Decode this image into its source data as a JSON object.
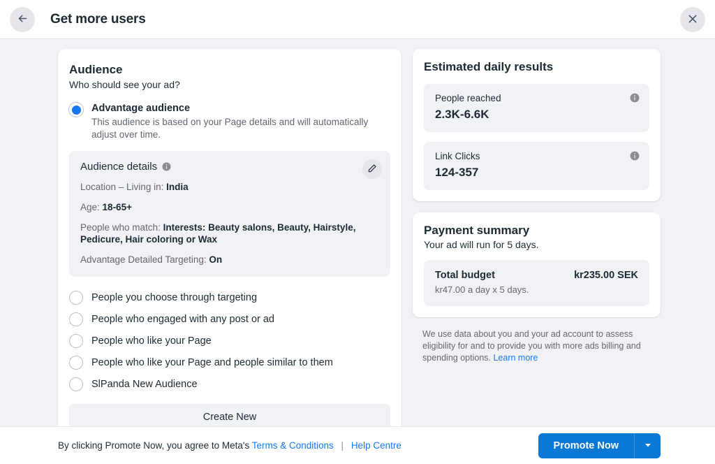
{
  "header": {
    "title": "Get more users",
    "back_icon": "arrow-left-icon",
    "close_icon": "close-icon"
  },
  "audience": {
    "title": "Audience",
    "subtitle": "Who should see your ad?",
    "selected_option": {
      "label": "Advantage audience",
      "description": "This audience is based on your Page details and will automatically adjust over time."
    },
    "details": {
      "title": "Audience details",
      "info_icon": "info-icon",
      "edit_icon": "pencil-icon",
      "rows": [
        {
          "label": "Location – Living in:",
          "value": "India"
        },
        {
          "label": "Age:",
          "value": "18-65+"
        },
        {
          "label": "People who match:",
          "value": "Interests: Beauty salons, Beauty, Hairstyle, Pedicure, Hair coloring or Wax"
        },
        {
          "label": "Advantage Detailed Targeting:",
          "value": "On"
        }
      ]
    },
    "options": [
      {
        "label": "People you choose through targeting",
        "selected": false
      },
      {
        "label": "People who engaged with any post or ad",
        "selected": false
      },
      {
        "label": "People who like your Page",
        "selected": false
      },
      {
        "label": "People who like your Page and people similar to them",
        "selected": false
      },
      {
        "label": "SlPanda New Audience",
        "selected": false
      }
    ],
    "create_new_label": "Create New"
  },
  "estimated_results": {
    "title": "Estimated daily results",
    "stats": [
      {
        "label": "People reached",
        "value": "2.3K-6.6K",
        "info_icon": "info-icon"
      },
      {
        "label": "Link Clicks",
        "value": "124-357",
        "info_icon": "info-icon"
      }
    ]
  },
  "payment_summary": {
    "title": "Payment summary",
    "subtitle": "Your ad will run for 5 days.",
    "budget_label": "Total budget",
    "budget_amount": "kr235.00 SEK",
    "budget_note": "kr47.00 a day x 5 days."
  },
  "disclaimer": {
    "text": "We use data about you and your ad account to assess eligibility for and to provide you with more ads billing and spending options.",
    "link_label": "Learn more"
  },
  "footer": {
    "agreement_prefix": "By clicking Promote Now, you agree to Meta's",
    "terms_label": "Terms & Conditions",
    "separator": "|",
    "help_label": "Help Centre",
    "promote_label": "Promote Now",
    "caret_icon": "chevron-down-icon"
  },
  "colors": {
    "accent": "#1877f2",
    "button": "#0a78d4",
    "page_bg": "#f0f2f5",
    "text": "#1c2b33",
    "muted": "#65676b"
  }
}
